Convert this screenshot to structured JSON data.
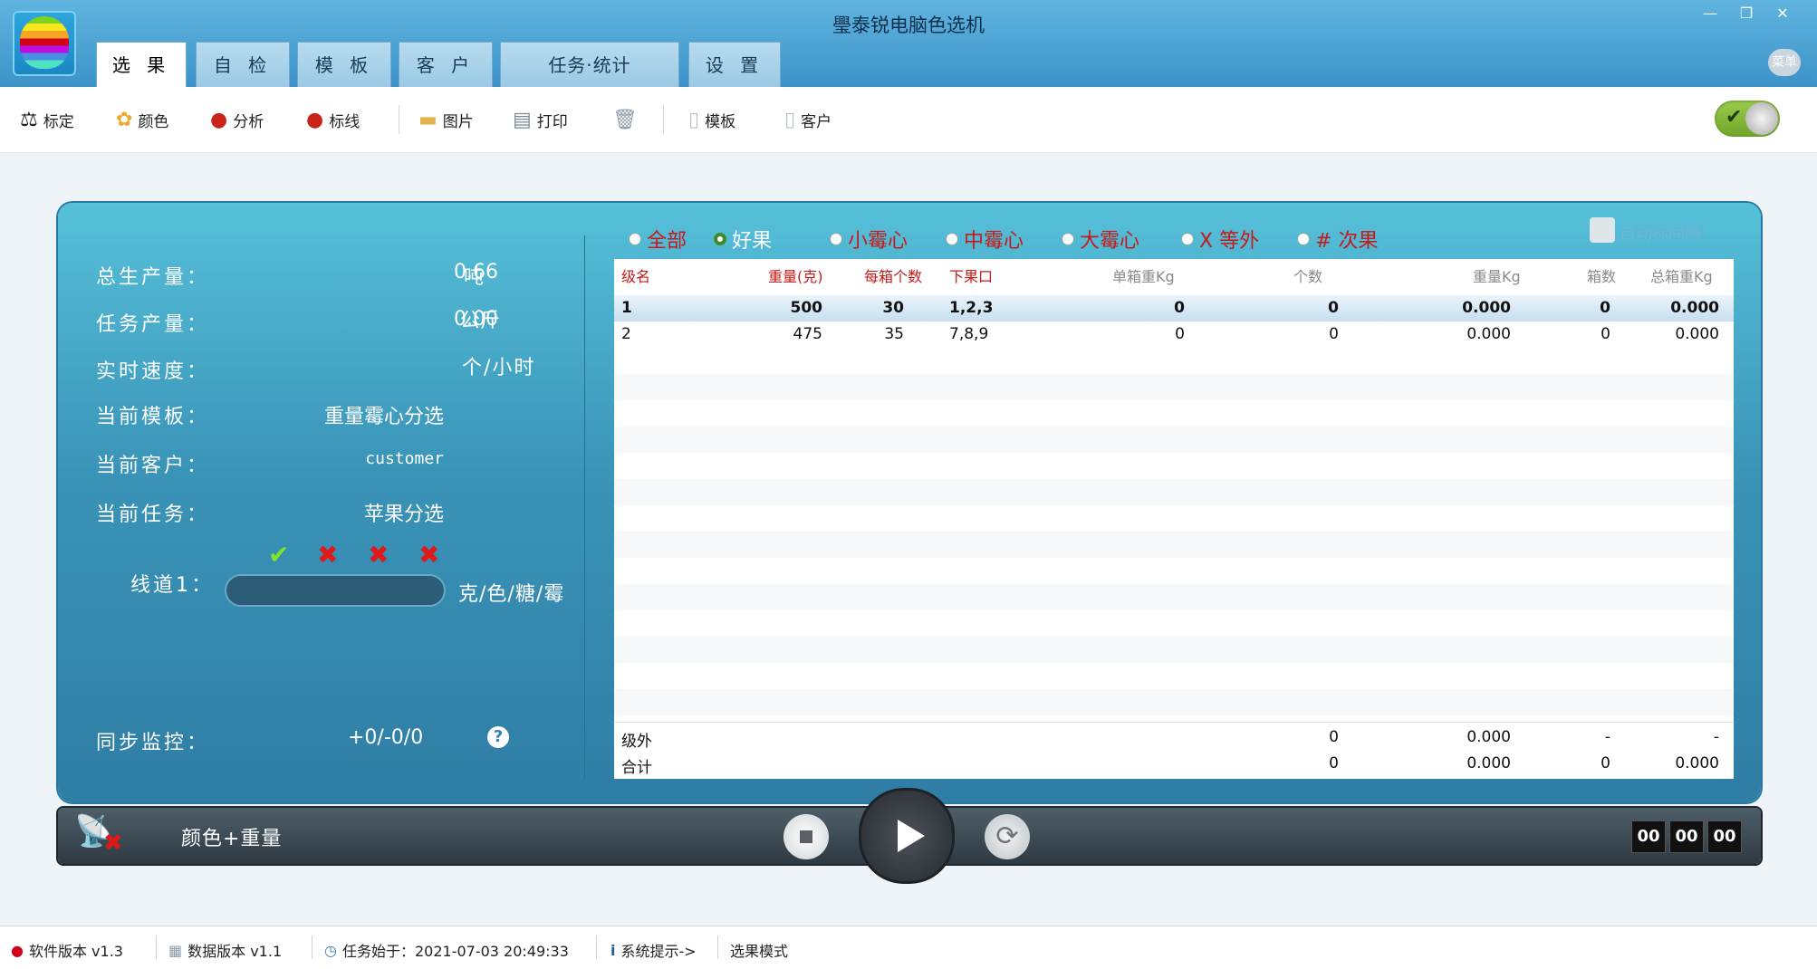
{
  "window": {
    "title": "璺泰锐电脑色选机",
    "menu_badge": "菜单"
  },
  "tabs": [
    "选 果",
    "自 检",
    "模 板",
    "客 户",
    "任务·统计",
    "设 置"
  ],
  "toolbar": {
    "calibrate": "标定",
    "color": "颜色",
    "analyze": "分析",
    "mark_line": "标线",
    "picture": "图片",
    "print": "打印",
    "template": "模板",
    "customer": "客户"
  },
  "stats": {
    "total_output_label": "总生产量：",
    "total_output_value": "0.66",
    "total_output_unit": "吨",
    "task_output_label": "任务产量：",
    "task_output_value": "0.00",
    "task_output_unit": "公斤",
    "speed_label": "实时速度：",
    "speed_unit": "个/小时",
    "template_label": "当前模板：",
    "template_value": "重量霉心分选",
    "customer_label": "当前客户：",
    "customer_value": "customer",
    "task_label": "当前任务：",
    "task_value": "苹果分选",
    "lane_label": "线道1：",
    "lane_unit": "克/色/糖/霉",
    "sync_label": "同步监控：",
    "sync_value": "+0/-0/0"
  },
  "filters": [
    "全部",
    "好果",
    "小霉心",
    "中霉心",
    "大霉心",
    "X 等外",
    "# 次果"
  ],
  "filter_selected": "好果",
  "filter_check_label": "自动标间隔",
  "table": {
    "headers": [
      "级名",
      "重量(克)",
      "每箱个数",
      "下果口",
      "单箱重Kg",
      "个数",
      "重量Kg",
      "箱数",
      "总箱重Kg"
    ],
    "rows": [
      [
        "1",
        "500",
        "30",
        "1,2,3",
        "0",
        "0",
        "0.000",
        "0",
        "0.000"
      ],
      [
        "2",
        "475",
        "35",
        "7,8,9",
        "0",
        "0",
        "0.000",
        "0",
        "0.000"
      ]
    ],
    "out_of_grade": [
      "级外",
      "0",
      "0.000",
      "-",
      "-"
    ],
    "total": [
      "合计",
      "0",
      "0.000",
      "0",
      "0.000"
    ]
  },
  "control": {
    "mode_text": "颜色+重量",
    "timer": [
      "00",
      "00",
      "00"
    ]
  },
  "statusbar": {
    "software_version": "软件版本 v1.3",
    "data_version": "数据版本 v1.1",
    "task_start": "任务始于：2021-07-03 20:49:33",
    "system_hint": "系统提示->",
    "mode": "选果模式"
  }
}
